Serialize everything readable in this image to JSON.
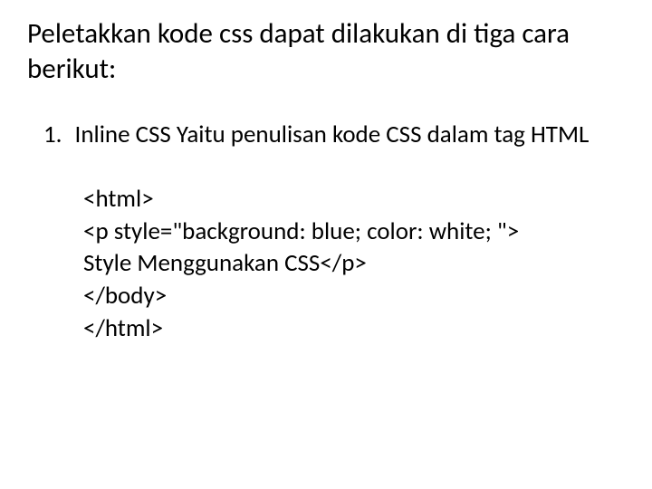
{
  "heading": "Peletakkan kode css dapat dilakukan di tiga cara berikut:",
  "list": {
    "number": "1.",
    "text": "Inline CSS Yaitu penulisan kode CSS dalam tag HTML"
  },
  "code": {
    "line1": "<html>",
    "line2": "<p style=\"background: blue; color: white; \">",
    "line3": "Style Menggunakan CSS</p>",
    "line4": "</body>",
    "line5": "</html>"
  }
}
